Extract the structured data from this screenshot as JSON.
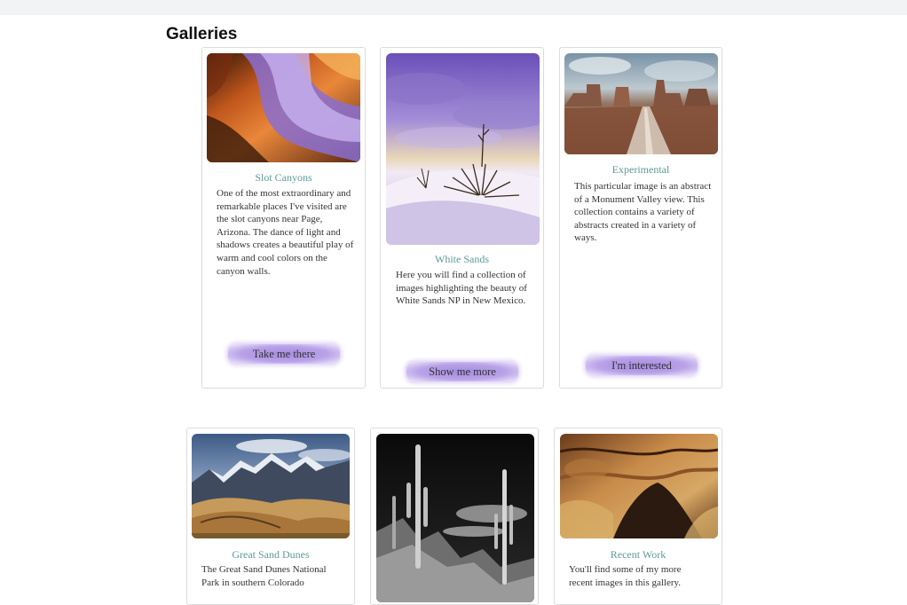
{
  "page": {
    "title": "Galleries"
  },
  "galleries": [
    {
      "name": "Slot Canyons",
      "description": "One of the most extraordinary and remarkable places I've visited are the slot canyons near Page, Arizona. The dance of light and shadows creates a beautiful play of warm and cool colors on the canyon walls.",
      "button": "Take me there"
    },
    {
      "name": "White Sands",
      "description": "Here you will find a collection of images highlighting the beauty of White Sands NP in New Mexico.",
      "button": "Show me more"
    },
    {
      "name": "Experimental",
      "description": "This particular image is an abstract of a Monument Valley view. This collection contains a variety of abstracts created in a variety of ways.",
      "button": "I'm interested"
    },
    {
      "name": "Great Sand Dunes",
      "description": "The Great Sand Dunes National Park in southern Colorado"
    },
    {
      "name": "",
      "description": ""
    },
    {
      "name": "Recent Work",
      "description": "You'll find some of my more recent images in this gallery."
    }
  ]
}
